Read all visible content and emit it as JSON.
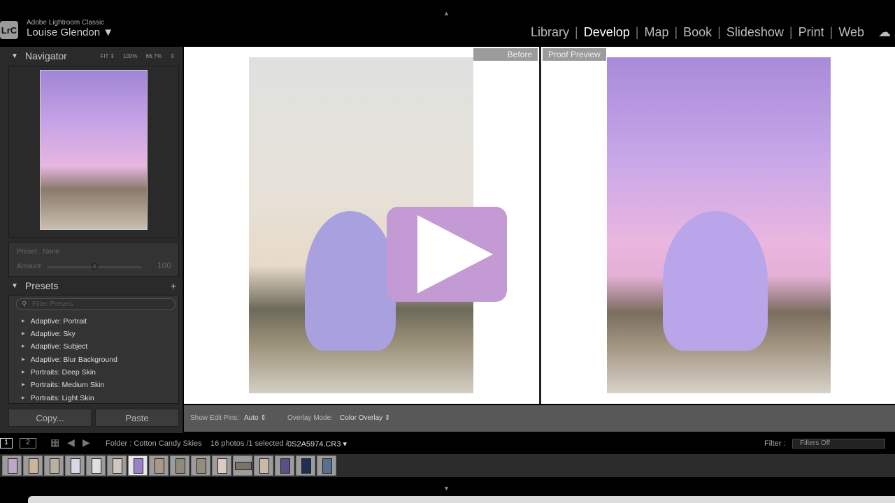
{
  "header": {
    "app_name": "Adobe Lightroom Classic",
    "logo": "LrC",
    "user": "Louise Glendon ▼",
    "modules": [
      "Library",
      "Develop",
      "Map",
      "Book",
      "Slideshow",
      "Print",
      "Web"
    ],
    "active_module": "Develop"
  },
  "navigator": {
    "title": "Navigator",
    "zoom": [
      "FIT ⇕",
      "100%",
      "66.7%",
      "⇕"
    ]
  },
  "preset_amount": {
    "preset": "Preset : None",
    "amount_label": "Amount",
    "amount_value": "100",
    "amount_fraction": 0.5
  },
  "presets": {
    "title": "Presets",
    "add": "+",
    "filter_placeholder": "Filter Presets",
    "items": [
      "Adaptive: Portrait",
      "Adaptive: Sky",
      "Adaptive: Subject",
      "Adaptive: Blur Background",
      "Portraits: Deep Skin",
      "Portraits: Medium Skin",
      "Portraits: Light Skin"
    ]
  },
  "buttons": {
    "copy": "Copy...",
    "paste": "Paste"
  },
  "views": {
    "before": "Before",
    "after": "Proof Preview"
  },
  "toolbar": {
    "edit_pins_label": "Show Edit Pins:",
    "edit_pins_value": "Auto ⇕",
    "overlay_label": "Overlay Mode:",
    "overlay_value": "Color Overlay ⇕"
  },
  "filmstrip": {
    "screen1": "1",
    "screen2": "2",
    "folder": "Folder : Cotton Candy Skies",
    "count": "16 photos /1 selected /",
    "file": "0S2A5974.CR3 ▾",
    "filter_label": "Filter :",
    "filter_value": "Filters Off"
  },
  "colors": {
    "play": "#c39ad4"
  }
}
